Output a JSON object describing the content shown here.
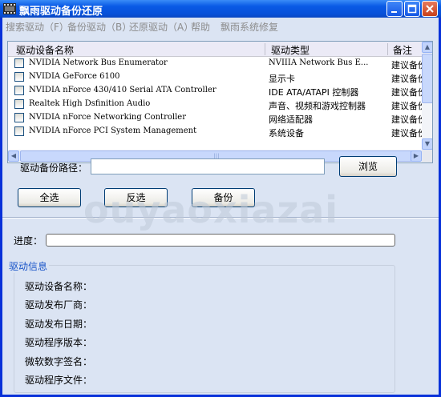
{
  "window": {
    "title": "飘雨驱动备份还原",
    "icon": "film-strip-icon",
    "controls": [
      "minimize",
      "maximize",
      "close"
    ]
  },
  "menu": [
    {
      "label": "搜索驱动（F）"
    },
    {
      "label": "备份驱动（B）"
    },
    {
      "label": "还原驱动（A）"
    },
    {
      "label": "帮助"
    },
    {
      "label": "飘雨系统修复"
    }
  ],
  "list": {
    "columns": [
      "驱动设备名称",
      "驱动类型",
      "备注"
    ],
    "rows": [
      {
        "checked": false,
        "name": "NVIDIA Network Bus Enumerator",
        "type": "NVIIIA Network Bus E...",
        "note": "建议备份"
      },
      {
        "checked": false,
        "name": "NVIDIA GeForce 6100",
        "type": "显示卡",
        "note": "建议备份"
      },
      {
        "checked": false,
        "name": "NVIDIA nForce 430/410 Serial ATA Controller",
        "type": "IDE ATA/ATAPI 控制器",
        "note": "建议备份"
      },
      {
        "checked": false,
        "name": "Realtek High Dsfinition Audio",
        "type": "声音、视频和游戏控制器",
        "note": "建议备份"
      },
      {
        "checked": false,
        "name": "NVIDIA nForce Networking Controller",
        "type": "网络适配器",
        "note": "建议备份"
      },
      {
        "checked": false,
        "name": "NVIDIA nForce PCI System Management",
        "type": "系统设备",
        "note": "建议备份"
      }
    ]
  },
  "backup": {
    "path_label": "驱动备份路径：",
    "path_value": "",
    "browse_label": "浏览",
    "select_all_label": "全选",
    "invert_label": "反选",
    "backup_label": "备份"
  },
  "progress": {
    "label": "进度：",
    "value": 0
  },
  "info": {
    "group_title": "驱动信息",
    "fields": [
      "驱动设备名称：",
      "驱动发布厂商：",
      "驱动发布日期：",
      "驱动程序版本：",
      "微软数字签名：",
      "驱动程序文件："
    ]
  },
  "watermark": "ouyaoxiazai"
}
